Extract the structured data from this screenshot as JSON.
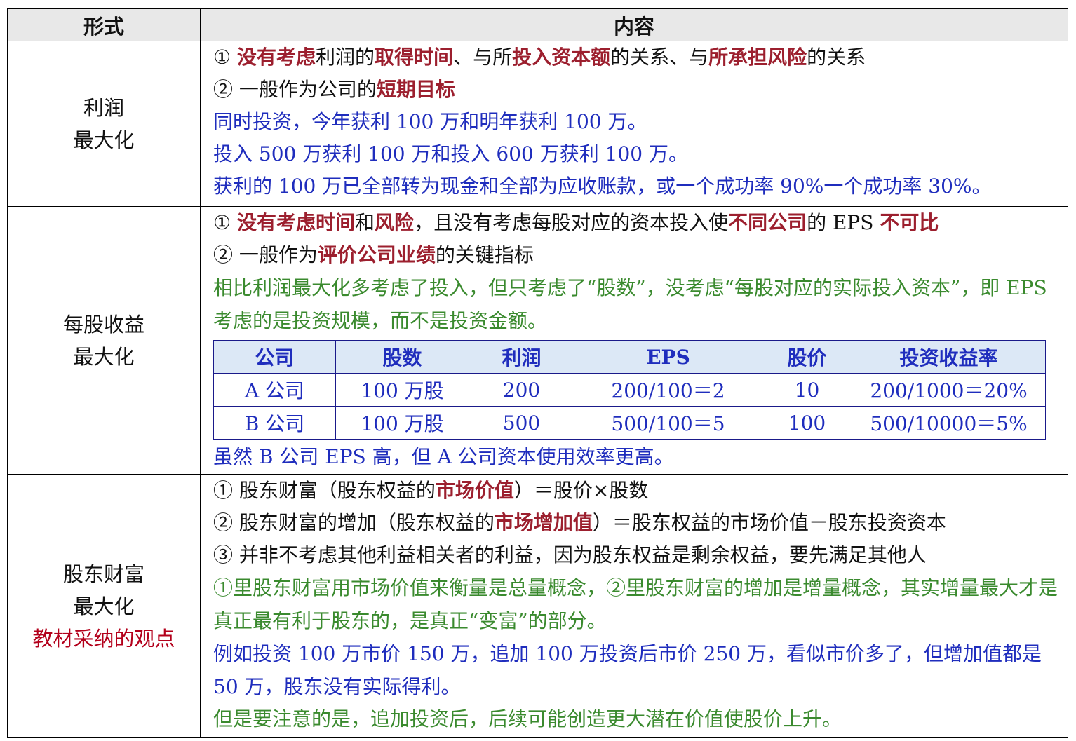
{
  "header": {
    "col1": "形式",
    "col2": "内容"
  },
  "rows": [
    {
      "label": [
        "利润",
        "最大化"
      ],
      "lines": [
        [
          "① ",
          "没有考虑",
          "利润的",
          "取得时间",
          "、与所",
          "投入资本额",
          "的关系、与",
          "所承担风险",
          "的关系"
        ],
        [
          "② 一般作为公司的",
          "短期目标"
        ],
        "同时投资，今年获利 100 万和明年获利 100 万。",
        "投入 500 万获利 100 万和投入 600 万获利 100 万。",
        "获利的 100 万已全部转为现金和全部为应收账款，或一个成功率 90%一个成功率 30%。"
      ]
    },
    {
      "label": [
        "每股收益",
        "最大化"
      ],
      "lines": [
        [
          "① ",
          "没有考虑时间",
          "和",
          "风险",
          "，且没有考虑每股对应的资本投入使",
          "不同公司",
          "的 EPS ",
          "不可比"
        ],
        [
          "② 一般作为",
          "评价公司业绩",
          "的关键指标"
        ],
        "相比利润最大化多考虑了投入，但只考虑了“股数”，没考虑“每股对应的实际投入资本”，即 EPS 考虑的是投资规模，而不是投资金额。",
        "虽然 B 公司 EPS 高，但 A 公司资本使用效率更高。"
      ],
      "table": {
        "headers": [
          "公司",
          "股数",
          "利润",
          "EPS",
          "股价",
          "投资收益率"
        ],
        "rows": [
          [
            "A 公司",
            "100 万股",
            "200",
            "200/100＝2",
            "10",
            "200/1000＝20%"
          ],
          [
            "B 公司",
            "100 万股",
            "500",
            "500/100＝5",
            "100",
            "500/10000＝5%"
          ]
        ]
      }
    },
    {
      "label": [
        "股东财富",
        "最大化"
      ],
      "label_note": "教材采纳的观点",
      "lines": [
        [
          "① 股东财富（股东权益的",
          "市场价值",
          "）＝股价×股数"
        ],
        [
          "② 股东财富的增加（股东权益的",
          "市场增加值",
          "）＝股东权益的市场价值－股东投资资本"
        ],
        "③ 并非不考虑其他利益相关者的利益，因为股东权益是剩余权益，要先满足其他人",
        "①里股东财富用市场价值来衡量是总量概念，②里股东财富的增加是增量概念，其实增量最大才是真正最有利于股东的，是真正“变富”的部分。",
        "例如投资 100 万市价 150 万，追加 100 万投资后市价 250 万，看似市价多了，但增加值都是 50 万，股东没有实际得利。",
        "但是要注意的是，追加投资后，后续可能创造更大潜在价值使股价上升。"
      ]
    }
  ],
  "colors": {
    "highlight": "#9c1f2e",
    "example": "#1f2dbd",
    "analysis": "#3a8a2e",
    "note": "#b3001b",
    "header_bg": "#e8e8e8",
    "table_header_bg": "#dce8f6"
  }
}
